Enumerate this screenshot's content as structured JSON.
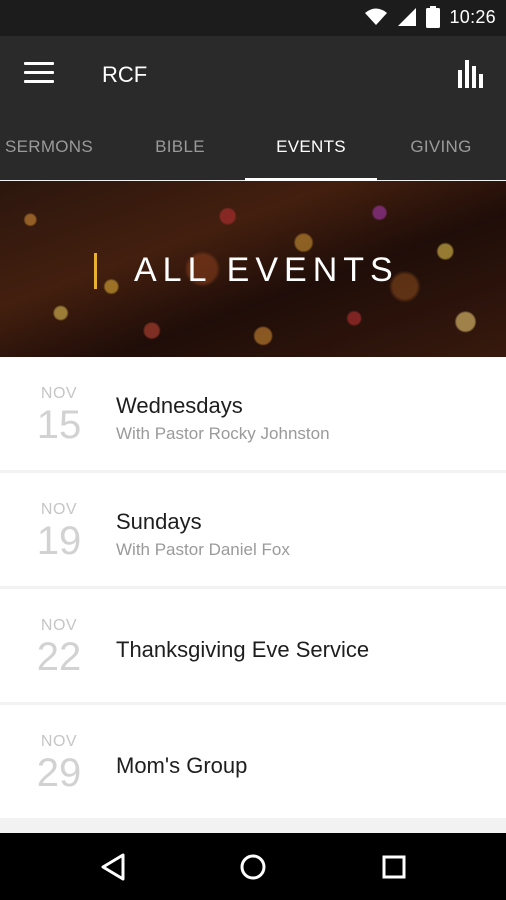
{
  "status_bar": {
    "time": "10:26"
  },
  "app_bar": {
    "title": "RCF"
  },
  "tabs": [
    {
      "label": "SERMONS",
      "active": false
    },
    {
      "label": "BIBLE",
      "active": false
    },
    {
      "label": "EVENTS",
      "active": true
    },
    {
      "label": "GIVING",
      "active": false
    }
  ],
  "hero": {
    "title": "ALL EVENTS"
  },
  "events": [
    {
      "month": "NOV",
      "day": "15",
      "title": "Wednesdays",
      "subtitle": "With Pastor Rocky Johnston"
    },
    {
      "month": "NOV",
      "day": "19",
      "title": "Sundays",
      "subtitle": "With Pastor Daniel Fox"
    },
    {
      "month": "NOV",
      "day": "22",
      "title": "Thanksgiving Eve Service",
      "subtitle": ""
    },
    {
      "month": "NOV",
      "day": "29",
      "title": "Mom's Group",
      "subtitle": ""
    }
  ],
  "icons": {
    "status": [
      "wifi-icon",
      "cell-signal-icon",
      "battery-icon"
    ],
    "app_bar": [
      "hamburger-menu-icon",
      "bar-chart-icon"
    ],
    "nav": [
      "back-icon",
      "home-icon",
      "recents-icon"
    ]
  },
  "colors": {
    "accent": "#e8b230",
    "app_bar": "#2a2a2a",
    "status_bar": "#1c1c1c"
  }
}
